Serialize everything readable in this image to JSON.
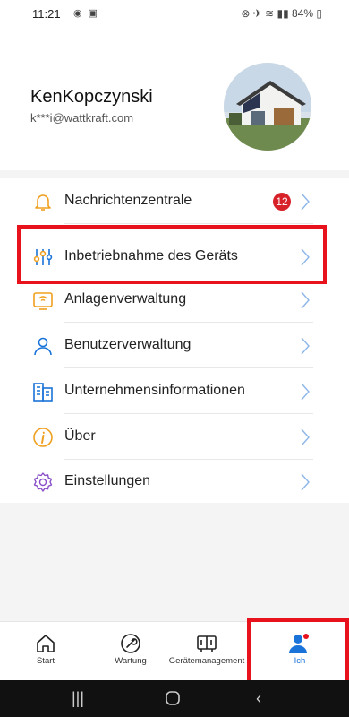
{
  "status_bar": {
    "time": "11:21",
    "battery": "84%"
  },
  "profile": {
    "name": "KenKopczynski",
    "email": "k***i@wattkraft.com"
  },
  "menu": {
    "items": [
      {
        "label": "Nachrichtenzentrale",
        "icon": "bell-icon",
        "badge": "12"
      },
      {
        "label": "Inbetriebnahme des Geräts",
        "icon": "sliders-icon"
      },
      {
        "label": "Anlagenverwaltung",
        "icon": "plant-monitor-icon"
      },
      {
        "label": "Benutzerverwaltung",
        "icon": "user-icon"
      },
      {
        "label": "Unternehmensinformationen",
        "icon": "building-icon"
      },
      {
        "label": "Über",
        "icon": "info-icon"
      },
      {
        "label": "Einstellungen",
        "icon": "gear-icon"
      }
    ]
  },
  "tabs": [
    {
      "label": "Start",
      "icon": "home-icon"
    },
    {
      "label": "Wartung",
      "icon": "wrench-icon"
    },
    {
      "label": "Gerätemanagement",
      "icon": "device-icon"
    },
    {
      "label": "Ich",
      "icon": "person-icon",
      "active": true
    }
  ],
  "colors": {
    "accent": "#1a73d9",
    "icon_orange": "#f0a020",
    "badge": "#d8222a",
    "highlight": "#e8121c"
  }
}
